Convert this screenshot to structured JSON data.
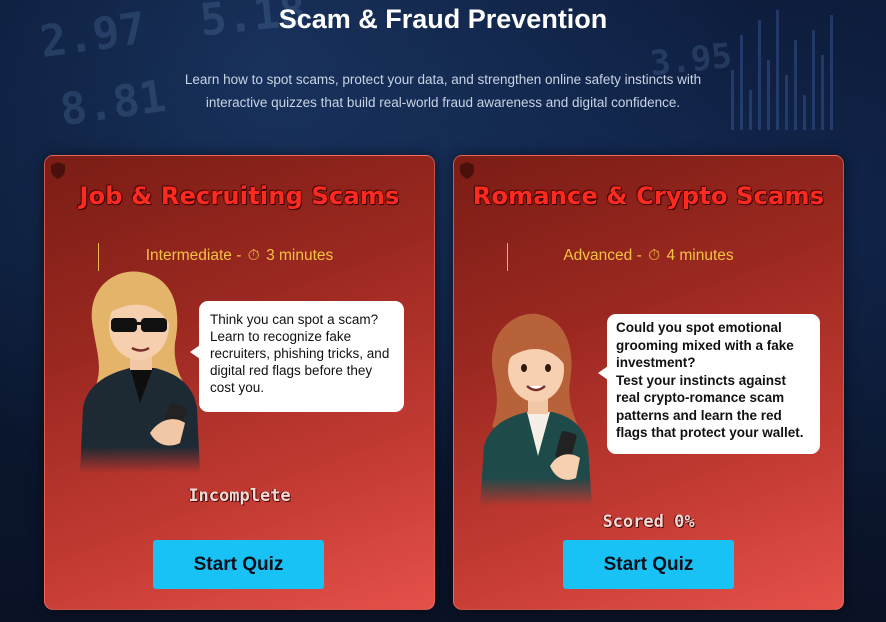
{
  "page": {
    "title": "Scam & Fraud Prevention",
    "subtitle_line1": "Learn how to spot scams, protect your data, and strengthen online safety instincts with",
    "subtitle_line2": "interactive quizzes that build real-world fraud awareness and digital confidence."
  },
  "background": {
    "numbers": [
      "2.97",
      "8.81",
      "5.18",
      "3.95"
    ]
  },
  "cards": [
    {
      "title": "Job & Recruiting Scams",
      "difficulty": "Intermediate",
      "separator": " - ",
      "clock_icon": "⏱",
      "duration": "3 minutes",
      "bubble_text": "Think you can spot a scam? Learn to recognize fake recruiters, phishing tricks, and digital red flags before they cost you.",
      "status": "Incomplete",
      "button_label": "Start Quiz"
    },
    {
      "title": "Romance & Crypto Scams",
      "difficulty": "Advanced",
      "separator": " - ",
      "clock_icon": "⏱",
      "duration": "4 minutes",
      "bubble_question": "Could you spot emotional grooming mixed with a fake investment?",
      "bubble_text": "Test your instincts against real crypto-romance scam patterns and learn the red flags that protect your wallet.",
      "status": "Scored 0%",
      "button_label": "Start Quiz"
    }
  ],
  "colors": {
    "card_title": "#ff2a1f",
    "meta_text": "#f5c242",
    "button_bg": "#18c2f5"
  },
  "icons": {
    "shield": "shield-icon",
    "clock": "stopwatch-icon"
  }
}
